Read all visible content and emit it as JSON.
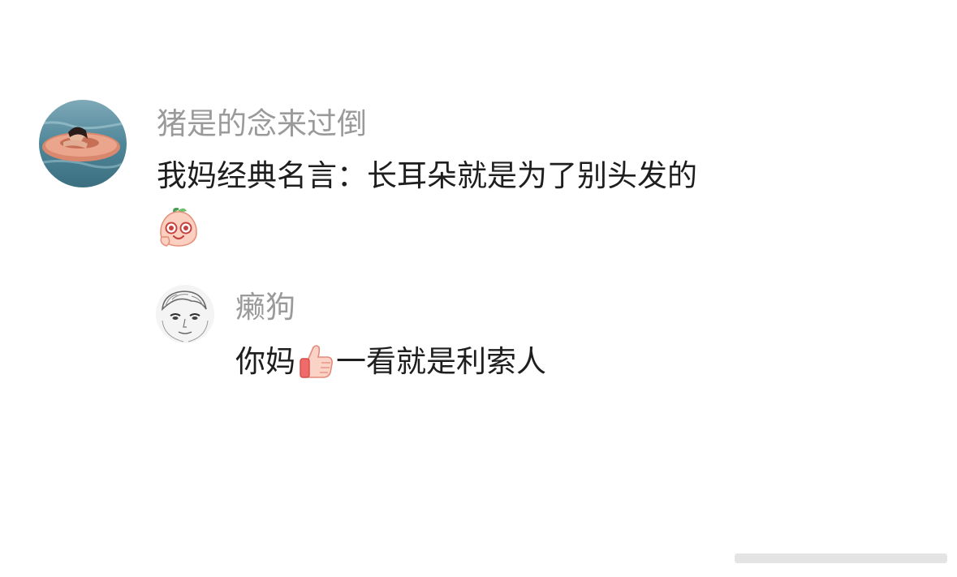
{
  "comments": [
    {
      "username": "猪是的念来过倒",
      "text": "我妈经典名言：长耳朵就是为了别头发的",
      "emoji": "smiling-peach-emoji"
    },
    {
      "username": "癞狗",
      "text_before": "你妈",
      "emoji": "thumbs-up-emoji",
      "text_after": "一看就是利索人"
    }
  ],
  "colors": {
    "username": "#9a9a9a",
    "text": "#1e1e1e",
    "background": "#ffffff"
  }
}
